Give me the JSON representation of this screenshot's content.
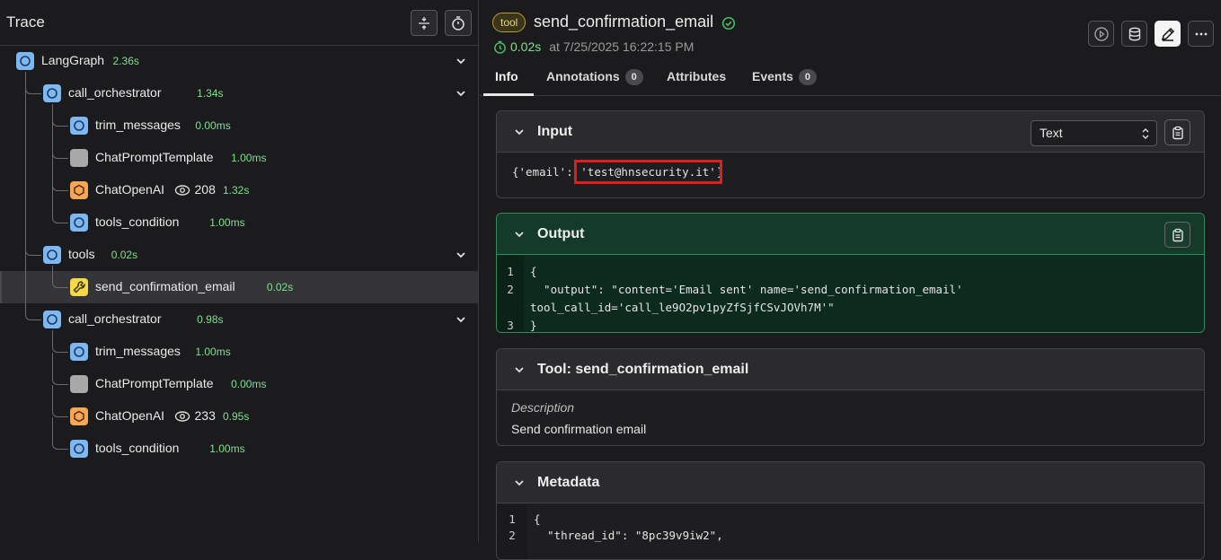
{
  "trace": {
    "title": "Trace",
    "nodes": [
      {
        "name": "LangGraph",
        "latency": "2.36s"
      },
      {
        "name": "call_orchestrator",
        "latency": "1.34s"
      },
      {
        "name": "trim_messages",
        "latency": "0.00ms"
      },
      {
        "name": "ChatPromptTemplate",
        "latency": "1.00ms"
      },
      {
        "name": "ChatOpenAI",
        "tokens": "208",
        "latency": "1.32s"
      },
      {
        "name": "tools_condition",
        "latency": "1.00ms"
      },
      {
        "name": "tools",
        "latency": "0.02s"
      },
      {
        "name": "send_confirmation_email",
        "latency": "0.02s"
      },
      {
        "name": "call_orchestrator",
        "latency": "0.98s"
      },
      {
        "name": "trim_messages",
        "latency": "1.00ms"
      },
      {
        "name": "ChatPromptTemplate",
        "latency": "0.00ms"
      },
      {
        "name": "ChatOpenAI",
        "tokens": "233",
        "latency": "0.95s"
      },
      {
        "name": "tools_condition",
        "latency": "1.00ms"
      }
    ]
  },
  "span": {
    "kind": "tool",
    "title": "send_confirmation_email",
    "latency": "0.02s",
    "timestamp": "at 7/25/2025 16:22:15 PM"
  },
  "tabs": {
    "info": "Info",
    "annotations": "Annotations",
    "annotations_count": "0",
    "attributes": "Attributes",
    "events": "Events",
    "events_count": "0"
  },
  "input": {
    "title": "Input",
    "format": "Text",
    "prefix": "{'email': ",
    "value": "'test@hnsecurity.it'",
    "suffix": "}"
  },
  "output": {
    "title": "Output",
    "lines": [
      {
        "n": "1",
        "text": "{"
      },
      {
        "n": "2",
        "text": "  \"output\": \"content='Email sent' name='send_confirmation_email'"
      },
      {
        "n": "",
        "text": "tool_call_id='call_le9O2pv1pyZfSjfCSvJOVh7M'\""
      },
      {
        "n": "3",
        "text": "}"
      }
    ]
  },
  "tool": {
    "title": "Tool: send_confirmation_email",
    "desc_label": "Description",
    "desc_value": "Send confirmation email"
  },
  "metadata": {
    "title": "Metadata",
    "lines": [
      {
        "n": "1",
        "text": "{"
      },
      {
        "n": "2",
        "text": "  \"thread_id\": \"8pc39v9iw2\","
      }
    ]
  },
  "colors": {
    "latency_green": "#7ee08f",
    "highlight_red": "#e11d1d",
    "output_bg": "#0d2a1f",
    "output_border": "#2f8a5c"
  }
}
